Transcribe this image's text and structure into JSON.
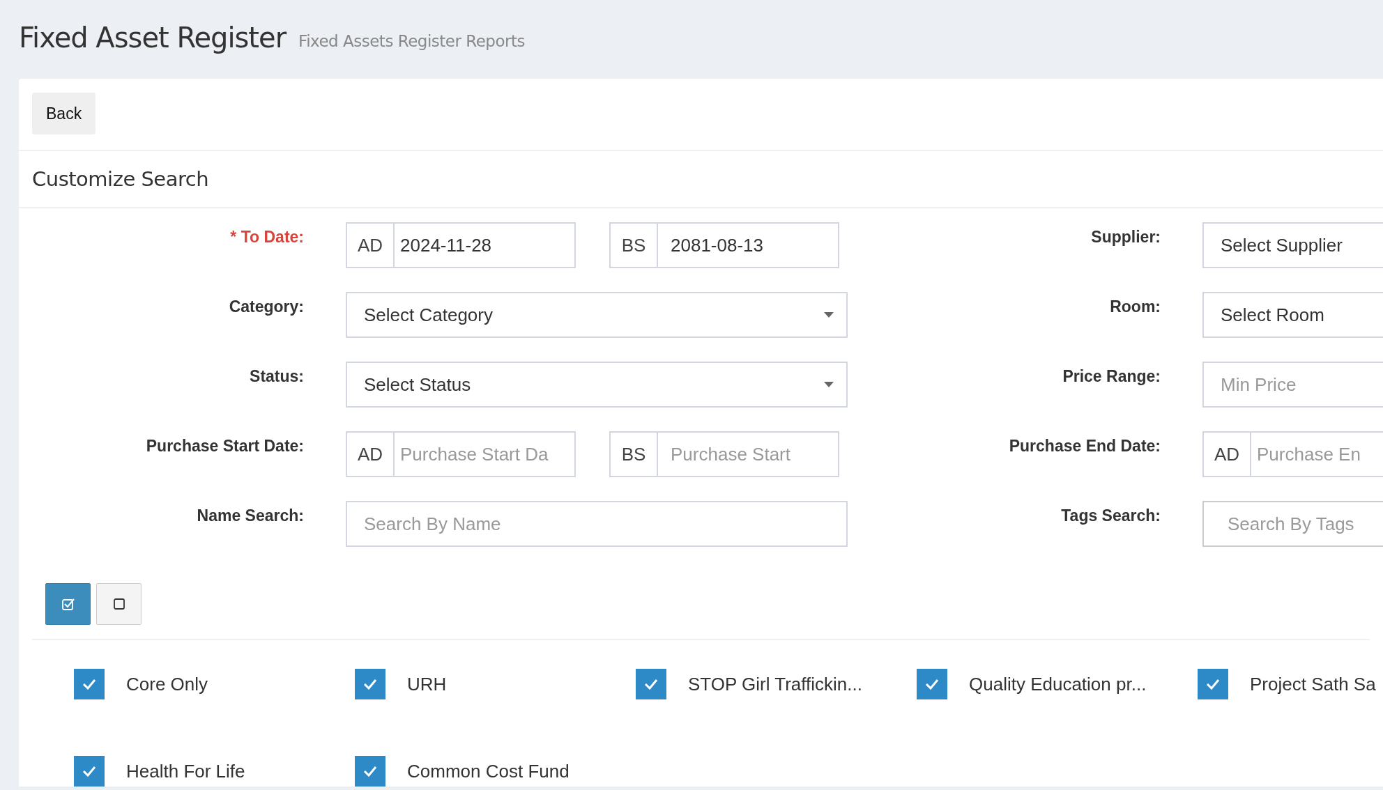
{
  "header": {
    "title": "Fixed Asset Register",
    "subtitle": "Fixed Assets Register Reports"
  },
  "back_button": "Back",
  "panel_title": "Customize Search",
  "left_fields": [
    {
      "label": "* To Date:",
      "required": true,
      "kind": "dates",
      "groups": [
        {
          "addon": "AD",
          "value": "2024-11-28"
        },
        {
          "addon": "BS",
          "value": "2081-08-13"
        }
      ]
    },
    {
      "label": "Category:",
      "required": false,
      "kind": "select",
      "value": "Select Category",
      "arrow": true
    },
    {
      "label": "Status:",
      "required": false,
      "kind": "select",
      "value": "Select Status",
      "arrow": true
    },
    {
      "label": "Purchase Start Date:",
      "required": false,
      "kind": "dates",
      "groups": [
        {
          "addon": "AD",
          "placeholder": "Purchase Start Da"
        },
        {
          "addon": "BS",
          "placeholder": "Purchase Start"
        }
      ]
    },
    {
      "label": "Name Search:",
      "required": false,
      "kind": "text",
      "placeholder": "Search By Name"
    }
  ],
  "right_fields": [
    {
      "label": "Supplier:",
      "required": false,
      "kind": "select",
      "value": "Select Supplier",
      "arrow": false
    },
    {
      "label": "Room:",
      "required": false,
      "kind": "select",
      "value": "Select Room",
      "arrow": false
    },
    {
      "label": "Price Range:",
      "required": false,
      "kind": "text",
      "placeholder": "Min Price"
    },
    {
      "label": "Purchase End Date:",
      "required": false,
      "kind": "dates",
      "groups": [
        {
          "addon": "AD",
          "placeholder": "Purchase En"
        }
      ]
    },
    {
      "label": "Tags Search:",
      "required": false,
      "kind": "tags",
      "placeholder": "Search By Tags"
    }
  ],
  "bulk_buttons": [
    {
      "kind": "check-all",
      "active": true
    },
    {
      "kind": "uncheck-all",
      "active": false
    }
  ],
  "projects": [
    {
      "label": "Core Only",
      "checked": true
    },
    {
      "label": "URH",
      "checked": true
    },
    {
      "label": "STOP Girl Traffickin...",
      "checked": true
    },
    {
      "label": "Quality Education pr...",
      "checked": true
    },
    {
      "label": "Project Sath Sa",
      "checked": true
    },
    {
      "label": "Health For Life",
      "checked": true
    },
    {
      "label": "Common Cost Fund",
      "checked": true
    }
  ]
}
